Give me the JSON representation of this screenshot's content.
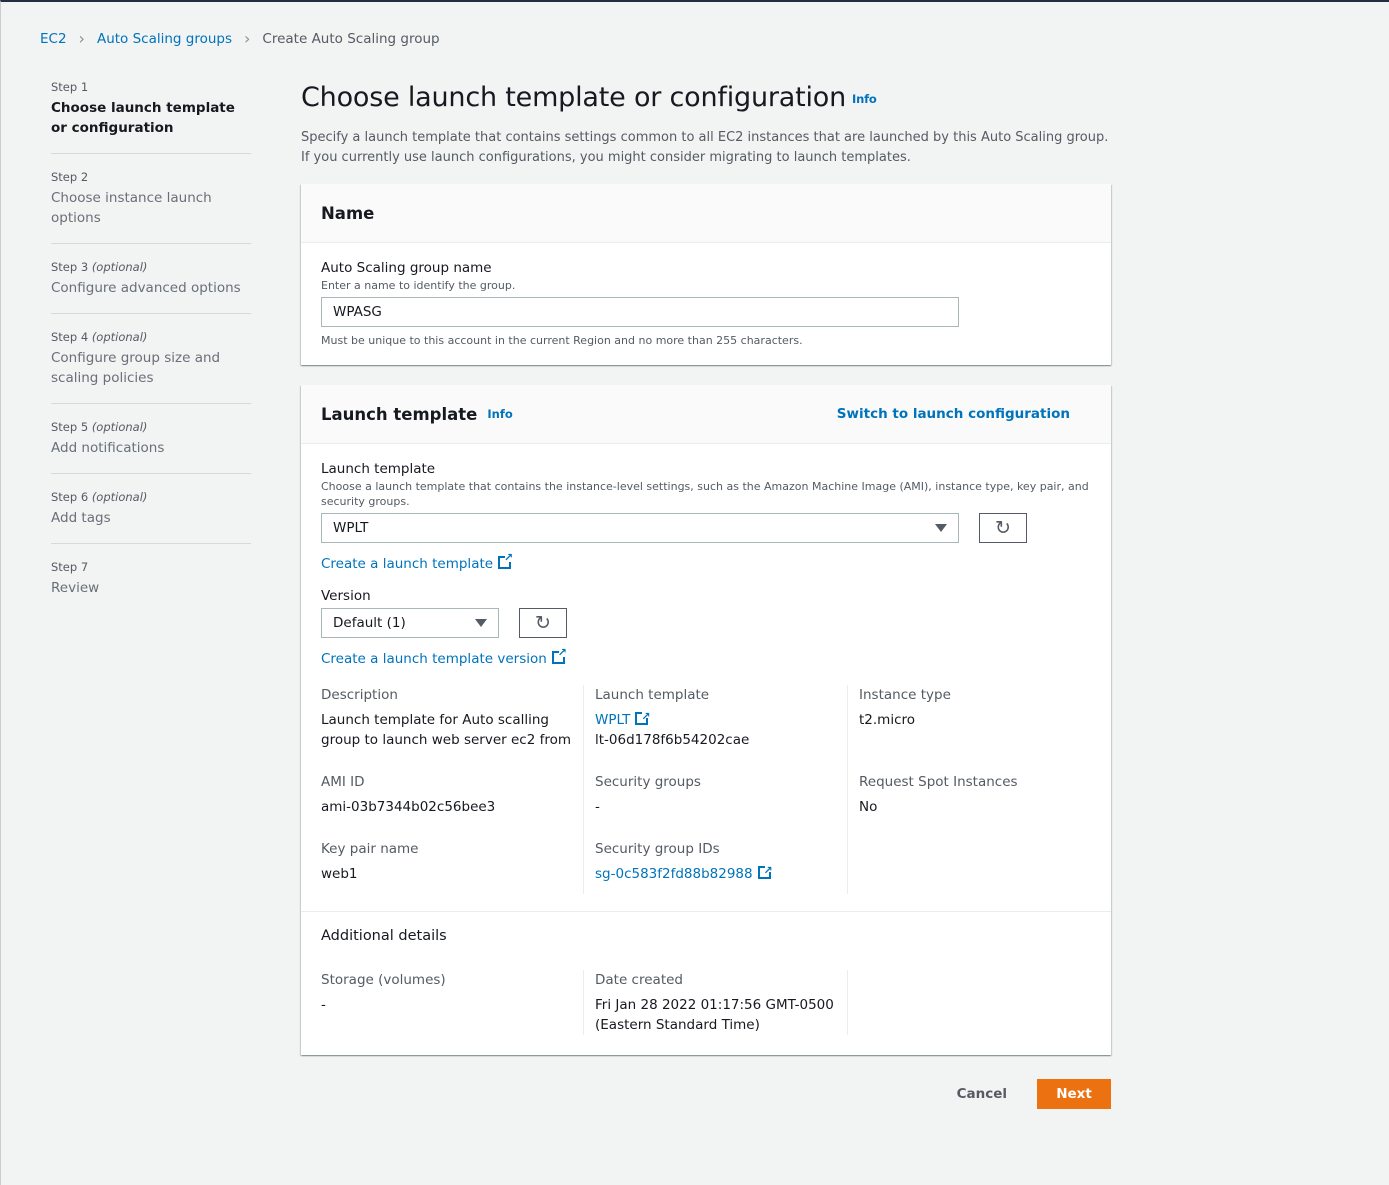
{
  "breadcrumb": [
    "EC2",
    "Auto Scaling groups",
    "Create Auto Scaling group"
  ],
  "steps": [
    {
      "n": "Step 1",
      "opt": "",
      "t": "Choose launch template or configuration"
    },
    {
      "n": "Step 2",
      "opt": "",
      "t": "Choose instance launch options"
    },
    {
      "n": "Step 3",
      "opt": "(optional)",
      "t": "Configure advanced options"
    },
    {
      "n": "Step 4",
      "opt": "(optional)",
      "t": "Configure group size and scaling policies"
    },
    {
      "n": "Step 5",
      "opt": "(optional)",
      "t": "Add notifications"
    },
    {
      "n": "Step 6",
      "opt": "(optional)",
      "t": "Add tags"
    },
    {
      "n": "Step 7",
      "opt": "",
      "t": "Review"
    }
  ],
  "page": {
    "title": "Choose launch template or configuration",
    "info": "Info",
    "desc": "Specify a launch template that contains settings common to all EC2 instances that are launched by this Auto Scaling group. If you currently use launch configurations, you might consider migrating to launch templates."
  },
  "name_panel": {
    "title": "Name",
    "label": "Auto Scaling group name",
    "hint": "Enter a name to identify the group.",
    "value": "WPASG",
    "constraint": "Must be unique to this account in the current Region and no more than 255 characters."
  },
  "lt_panel": {
    "title": "Launch template",
    "info": "Info",
    "switch": "Switch to launch configuration",
    "label": "Launch template",
    "hint": "Choose a launch template that contains the instance-level settings, such as the Amazon Machine Image (AMI), instance type, key pair, and security groups.",
    "value": "WPLT",
    "create_link": "Create a launch template",
    "version_label": "Version",
    "version_value": "Default (1)",
    "create_version_link": "Create a launch template version",
    "details": {
      "description_k": "Description",
      "description_v": "Launch template for Auto scalling group to launch web server ec2 from",
      "ami_k": "AMI ID",
      "ami_v": "ami-03b7344b02c56bee3",
      "key_k": "Key pair name",
      "key_v": "web1",
      "lt_k": "Launch template",
      "lt_name": "WPLT",
      "lt_id": "lt-06d178f6b54202cae",
      "sg_k": "Security groups",
      "sg_v": "-",
      "sgid_k": "Security group IDs",
      "sgid_v": "sg-0c583f2fd88b82988",
      "it_k": "Instance type",
      "it_v": "t2.micro",
      "spot_k": "Request Spot Instances",
      "spot_v": "No"
    },
    "additional": {
      "title": "Additional details",
      "storage_k": "Storage (volumes)",
      "storage_v": "-",
      "date_k": "Date created",
      "date_v": "Fri Jan 28 2022 01:17:56 GMT-0500 (Eastern Standard Time)"
    }
  },
  "footer": {
    "cancel": "Cancel",
    "next": "Next"
  }
}
